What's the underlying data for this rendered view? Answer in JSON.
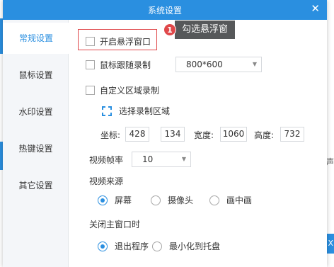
{
  "window": {
    "title": "系统设置"
  },
  "sidebar": {
    "items": [
      {
        "label": "常规设置",
        "active": true
      },
      {
        "label": "鼠标设置",
        "active": false
      },
      {
        "label": "水印设置",
        "active": false
      },
      {
        "label": "热键设置",
        "active": false
      },
      {
        "label": "其它设置",
        "active": false
      }
    ]
  },
  "options": {
    "float_window": {
      "label": "开启悬浮窗口",
      "checked": false
    },
    "follow_mouse": {
      "label": "鼠标跟随录制",
      "checked": false,
      "resolution": "800*600"
    },
    "custom_region": {
      "label": "自定义区域录制",
      "checked": false
    }
  },
  "region": {
    "select_label": "选择录制区域",
    "coord_label": "坐标:",
    "x": "428",
    "y": "134",
    "width_label": "宽度:",
    "width": "1060",
    "height_label": "高度:",
    "height": "732"
  },
  "framerate": {
    "label": "视频帧率",
    "value": "10"
  },
  "source": {
    "label": "视频来源",
    "options": [
      {
        "label": "屏幕",
        "checked": true
      },
      {
        "label": "摄像头",
        "checked": false
      },
      {
        "label": "画中画",
        "checked": false
      }
    ]
  },
  "on_close": {
    "label": "关闭主窗口时",
    "options": [
      {
        "label": "退出程序",
        "checked": true
      },
      {
        "label": "最小化到托盘",
        "checked": false
      }
    ]
  },
  "callout": {
    "number": "1",
    "text": "勾选悬浮窗"
  },
  "background": {
    "right_text": "声",
    "right_button_text": "X"
  },
  "colors": {
    "accent": "#2a8fe0",
    "highlight": "#e0484a",
    "callout_bg": "#56585a"
  }
}
